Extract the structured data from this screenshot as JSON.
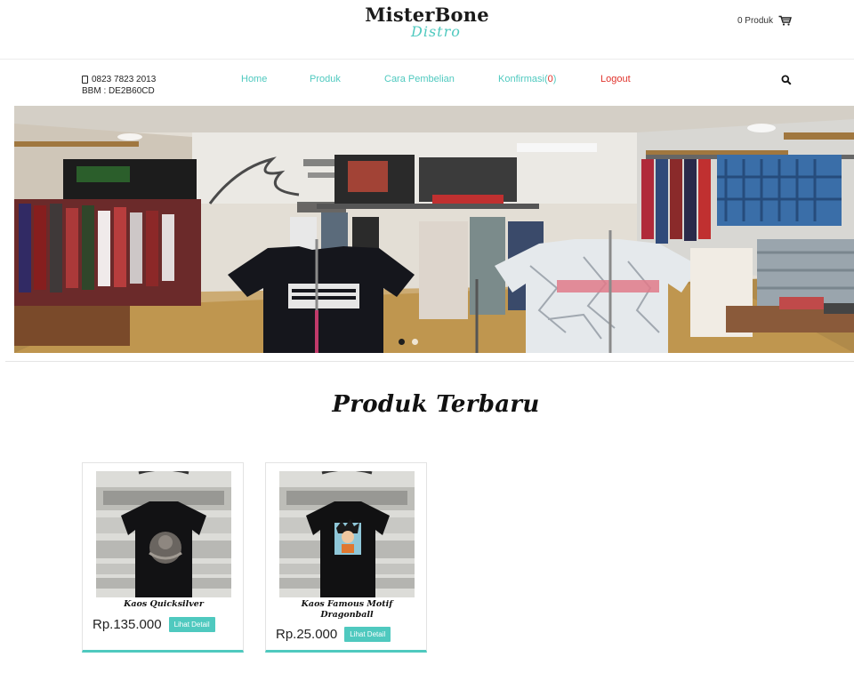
{
  "brand": {
    "name": "MisterBone",
    "tagline": "Distro"
  },
  "cart": {
    "label": "0 Produk"
  },
  "contact": {
    "phone": "0823 7823 2013",
    "bbm": "BBM : DE2B60CD"
  },
  "nav": {
    "home": "Home",
    "produk": "Produk",
    "cara": "Cara Pembelian",
    "konfirmasi_label": "Konfirmasi(",
    "konfirmasi_count": "0",
    "konfirmasi_close": ")",
    "logout": "Logout"
  },
  "slider": {
    "slides": 2,
    "active": 0
  },
  "section": {
    "title": "Produk Terbaru"
  },
  "products": [
    {
      "name": "Kaos Quicksilver",
      "name_line2": "",
      "price": "Rp.135.000",
      "button": "Lihat Detail"
    },
    {
      "name": "Kaos Famous Motif",
      "name_line2": "Dragonball",
      "price": "Rp.25.000",
      "button": "Lihat Detail"
    }
  ],
  "colors": {
    "accent": "#4fc9bf",
    "alert": "#e0322b",
    "text": "#222222"
  }
}
